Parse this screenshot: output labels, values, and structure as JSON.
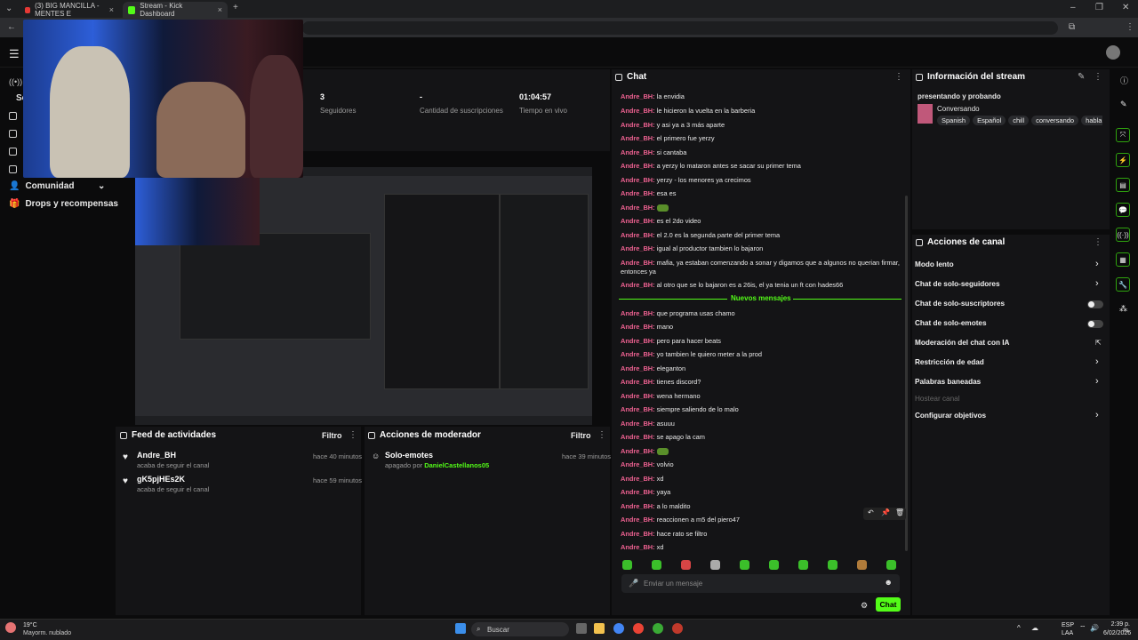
{
  "browser": {
    "tabs": [
      {
        "title": "(3) BIG MANCILLA - MENTES E",
        "close": "×"
      },
      {
        "title": "Stream - Kick Dashboard",
        "close": "×"
      }
    ],
    "new_tab": "+"
  },
  "stats": [
    {
      "value": "3",
      "label": "Seguidores"
    },
    {
      "value": "-",
      "label": "Cantidad de suscripciones"
    },
    {
      "value": "01:04:57",
      "label": "Tiempo en vivo"
    }
  ],
  "sidebar": {
    "partial_label": "Se",
    "items": [
      {
        "label": "Comunidad",
        "chevron": "⌄"
      },
      {
        "label": "Drops y recompensas"
      }
    ]
  },
  "feed": {
    "title": "Feed de actividades",
    "filter": "Filtro",
    "items": [
      {
        "name": "Andre_BH",
        "sub": "acaba de seguir el canal",
        "time": "hace 40 minutos"
      },
      {
        "name": "gK5pjHEs2K",
        "sub": "acaba de seguir el canal",
        "time": "hace 59 minutos"
      }
    ]
  },
  "mod": {
    "title": "Acciones de moderador",
    "filter": "Filtro",
    "item": {
      "name": "Solo-emotes",
      "sub_prefix": "apagado por",
      "sub_user": "DanielCastellanos05",
      "time": "hace 39 minutos"
    }
  },
  "chat": {
    "title": "Chat",
    "user": "Andre_BH:",
    "messages_before": [
      "la envidia",
      "le hicieron la vuelta en la barberia",
      "y asi ya a 3 más aparte",
      "el primero fue yerzy",
      "si cantaba",
      "a yerzy lo mataron antes se sacar su primer tema",
      "yerzy - los menores ya crecimos",
      "esa es",
      "",
      "es el 2do video",
      "el 2.0 es la segunda parte del primer tema",
      "igual al productor tambien lo bajaron",
      "mafia, ya estaban comenzando a sonar y digamos que a algunos no querian firmar,",
      "al otro que se lo bajaron es a 26is, el ya tenia un ft con hades66"
    ],
    "wrap_line": "entonces ya",
    "new_messages_label": "Nuevos mensajes",
    "messages_after": [
      "que programa usas chamo",
      "mano",
      "pero para hacer beats",
      "yo tambien le quiero meter a la prod",
      "eleganton",
      "tienes discord?",
      "wena hermano",
      "siempre saliendo de lo malo",
      "asuuu",
      "se apago la cam",
      "",
      "volvio",
      "xd",
      "yaya",
      "a lo maldito",
      "reaccionen a m5 del piero47",
      "hace rato se filtro",
      "xd"
    ],
    "input_placeholder": "Enviar un mensaje",
    "send_label": "Chat"
  },
  "stream_info": {
    "title": "Información del stream",
    "stream_title": "presentando y probando",
    "category": "Conversando",
    "tags": [
      "Spanish",
      "Español",
      "chill",
      "conversando",
      "hablan"
    ]
  },
  "channel_actions": {
    "title": "Acciones de canal",
    "items": [
      {
        "label": "Modo lento",
        "control": "chevron"
      },
      {
        "label": "Chat de solo-seguidores",
        "control": "chevron"
      },
      {
        "label": "Chat de solo-suscriptores",
        "control": "toggle"
      },
      {
        "label": "Chat de solo-emotes",
        "control": "toggle"
      },
      {
        "label": "Moderación del chat con IA",
        "control": "external"
      },
      {
        "label": "Restricción de edad",
        "control": "chevron"
      },
      {
        "label": "Palabras baneadas",
        "control": "chevron"
      },
      {
        "label": "Hostear canal",
        "control": "disabled"
      },
      {
        "label": "Configurar objetivos",
        "control": "chevron"
      }
    ]
  },
  "taskbar": {
    "weather_temp": "19°C",
    "weather_desc": "Mayorm. nublado",
    "search": "Buscar",
    "lang": "ESP",
    "lang2": "LAA",
    "time": "2:39 p. m.",
    "date": "6/02/2026"
  },
  "colors": {
    "accent": "#53fc18",
    "username": "#f06292",
    "panel": "#141416",
    "bg": "#0b0b0c"
  }
}
